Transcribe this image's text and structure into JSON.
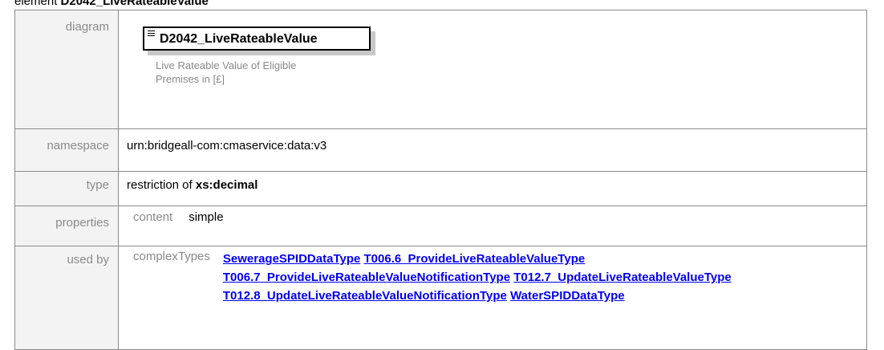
{
  "heading": {
    "prefix": "element",
    "name": "D2042_LiveRateableValue"
  },
  "rows": {
    "diagram": {
      "label": "diagram",
      "element_name": "D2042_LiveRateableValue",
      "annotation_line1": "Live Rateable Value of Eligible",
      "annotation_line2": "Premises in [£]"
    },
    "namespace": {
      "label": "namespace",
      "value": "urn:bridgeall-com:cmaservice:data:v3"
    },
    "type": {
      "label": "type",
      "prefix": "restriction of",
      "base": "xs:decimal"
    },
    "properties": {
      "label": "properties",
      "key": "content",
      "value": "simple"
    },
    "used_by": {
      "label": "used by",
      "key": "complexTypes",
      "links": [
        "SewerageSPIDDataType",
        "T006.6_ProvideLiveRateableValueType",
        "T006.7_ProvideLiveRateableValueNotificationType",
        "T012.7_UpdateLiveRateableValueType",
        "T012.8_UpdateLiveRateableValueNotificationType",
        "WaterSPIDDataType"
      ]
    }
  },
  "icons": {
    "element": "element-icon"
  },
  "colors": {
    "label_bg": "#f3f3f3",
    "label_text": "#8a8a8a",
    "link": "#0000ee",
    "border": "#8a8a8a"
  }
}
